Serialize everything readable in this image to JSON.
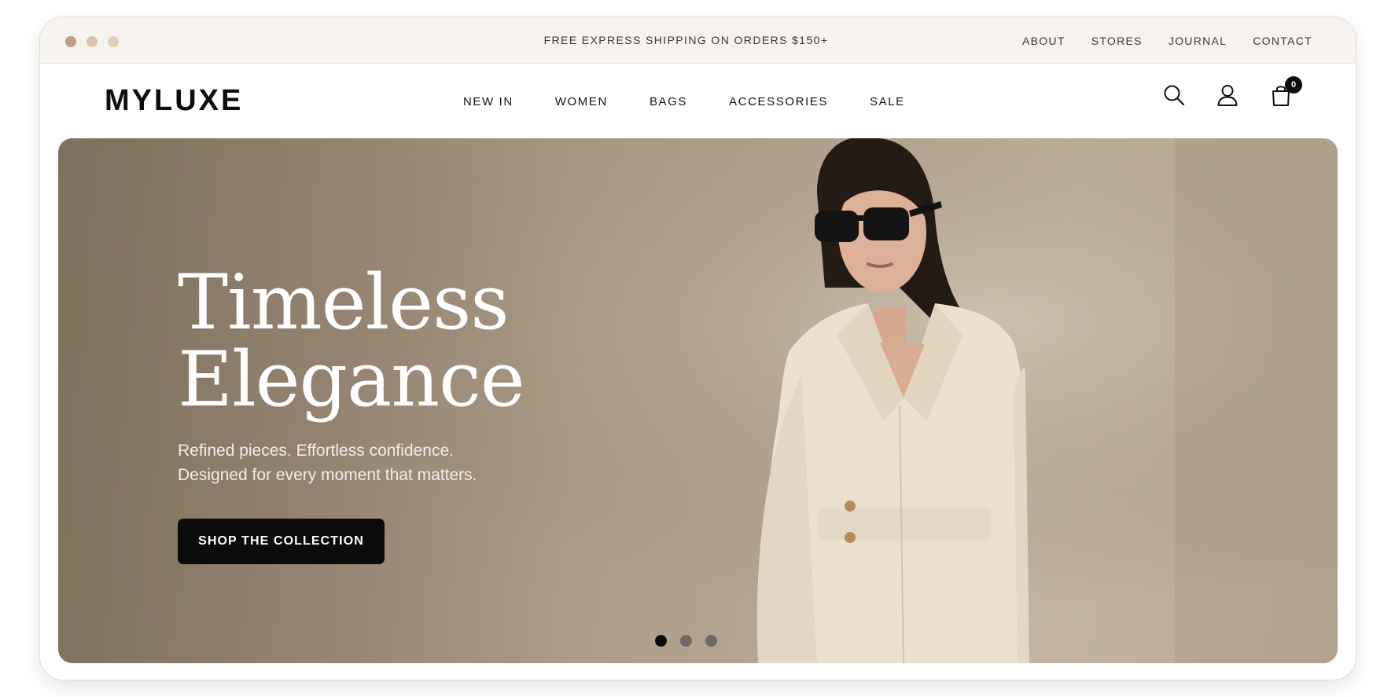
{
  "window": {
    "dot_colors": [
      "#c29c87",
      "#dcc2ae",
      "#e3cdb5"
    ]
  },
  "topbar": {
    "promo": "FREE EXPRESS SHIPPING ON ORDERS $150+",
    "links": [
      "ABOUT",
      "STORES",
      "JOURNAL",
      "CONTACT"
    ]
  },
  "header": {
    "logo": "MYLUXE",
    "nav": [
      "NEW IN",
      "WOMEN",
      "BAGS",
      "ACCESSORIES",
      "SALE"
    ],
    "icons": [
      "search-icon",
      "account-icon",
      "bag-icon"
    ],
    "cart_count": "0"
  },
  "hero": {
    "headline_line1": "Timeless",
    "headline_line2": "Elegance",
    "subtitle_line1": "Refined pieces. Effortless confidence.",
    "subtitle_line2": "Designed for every moment that matters.",
    "cta_label": "SHOP THE COLLECTION",
    "slides": 3,
    "active_slide": 1,
    "colors": {
      "background": "#a3927e",
      "blazer": "#eee3d4",
      "cta": "#0b0b0b"
    }
  }
}
